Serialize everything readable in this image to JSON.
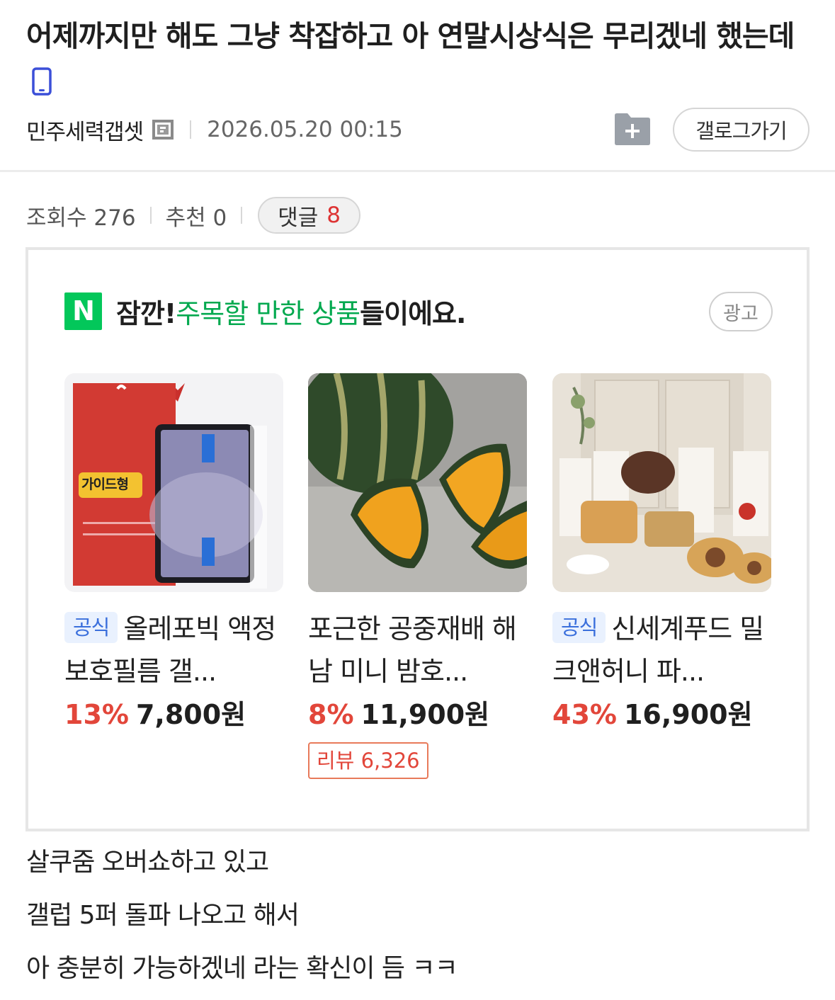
{
  "post": {
    "title": "어제까지만 해도 그냥 착잡하고 아 연말시상식은 무리겠네 했는데",
    "author": "민주세력갭셋",
    "date": "2026.05.20 00:15",
    "gallog_button": "갤로그가기",
    "views_label": "조회수 276",
    "recommend_label": "추천 0",
    "comments_label": "댓글",
    "comments_count": "8"
  },
  "ad": {
    "logo_letter": "N",
    "heading_prefix": "잠깐! ",
    "heading_highlight": "주목할 만한 상품",
    "heading_suffix": "들이에요.",
    "badge": "광고",
    "products": [
      {
        "official": "공식",
        "name": "올레포빅 액정보호필름 갤...",
        "discount": "13%",
        "price": "7,800원",
        "thumb_text": "가이드형"
      },
      {
        "official": "",
        "name": "포근한 공중재배 해남 미니 밤호...",
        "discount": "8%",
        "price": "11,900원",
        "review": "리뷰 6,326"
      },
      {
        "official": "공식",
        "name": "신세계푸드 밀크앤허니 파...",
        "discount": "43%",
        "price": "16,900원"
      }
    ]
  },
  "body": {
    "lines": [
      "살쿠줌 오버쇼하고 있고",
      "갤럽 5퍼 돌파 나오고 해서",
      "아 충분히 가능하겠네 라는 확신이 듬 ㅋㅋ"
    ]
  },
  "colors": {
    "accent_green": "#03c75a",
    "discount_red": "#e2463a",
    "official_blue": "#3a6fdc"
  }
}
